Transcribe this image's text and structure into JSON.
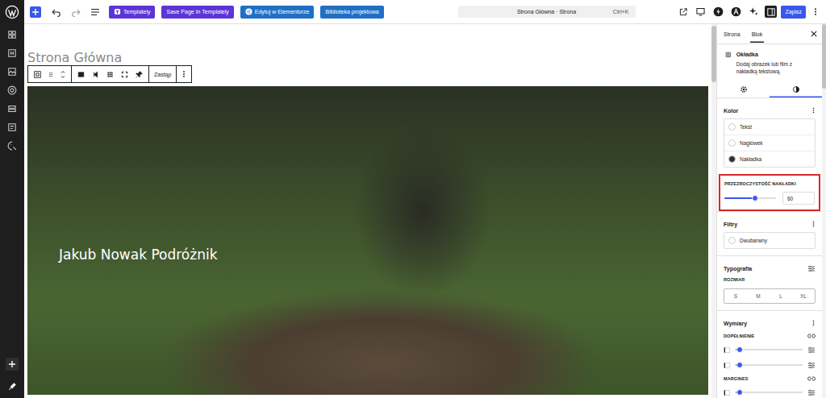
{
  "topbar": {
    "actions": [
      {
        "label": "Templately",
        "kind": "templately",
        "color": "#5b35d5"
      },
      {
        "label": "Save Page In Templately",
        "kind": "plain",
        "color": "#5b35d5"
      },
      {
        "label": "Edytuj w Elementorze",
        "kind": "elementor",
        "color": "#1f6fc5"
      },
      {
        "label": "Biblioteka projektowa",
        "kind": "plain",
        "color": "#1f6fc5"
      }
    ],
    "document": {
      "title": "Strona Główna · Strona",
      "shortcut": "Ctrl+K"
    },
    "save": "Zapisz"
  },
  "canvas": {
    "page_title": "Strona Główna",
    "block_toolbar": {
      "replace": "Zastąp"
    },
    "cover": {
      "heading": "Jakub Nowak Podróżnik"
    }
  },
  "sidebar": {
    "tabs": [
      {
        "label": "Strona",
        "selected": false
      },
      {
        "label": "Blok",
        "selected": true
      }
    ],
    "block": {
      "name": "Okładka",
      "description": "Dodaj obrazek lub film z nakładką tekstową."
    },
    "panel_tabs": [
      {
        "kind": "settings",
        "selected": false
      },
      {
        "kind": "styles",
        "selected": true
      }
    ],
    "color": {
      "title": "Kolor",
      "items": [
        {
          "label": "Tekst",
          "color": "#ffffff"
        },
        {
          "label": "Nagłówek",
          "color": "#ffffff"
        },
        {
          "label": "Nakładka",
          "color": "#2f2f2f"
        }
      ]
    },
    "overlay_opacity": {
      "label": "PRZEZROCZYSTOŚĆ NAKŁADKI",
      "level": 0.6,
      "value": "60",
      "highlighted": true
    },
    "filters": {
      "title": "Filtry",
      "items": [
        {
          "label": "Dwubarwny"
        }
      ]
    },
    "typography": {
      "title": "Typografia",
      "size_label": "ROZMIAR",
      "sizes": [
        {
          "label": "S",
          "selected": false
        },
        {
          "label": "M",
          "selected": false
        },
        {
          "label": "L",
          "selected": false
        },
        {
          "label": "XL",
          "selected": false
        }
      ]
    },
    "dimensions": {
      "title": "Wymiary",
      "groups": [
        {
          "label": "DOPEŁNIENIE",
          "sliders": [
            {
              "level": 0.06
            },
            {
              "level": 0.06
            }
          ]
        },
        {
          "label": "MARGINES",
          "sliders": [
            {
              "level": 0.06
            }
          ]
        }
      ]
    }
  }
}
